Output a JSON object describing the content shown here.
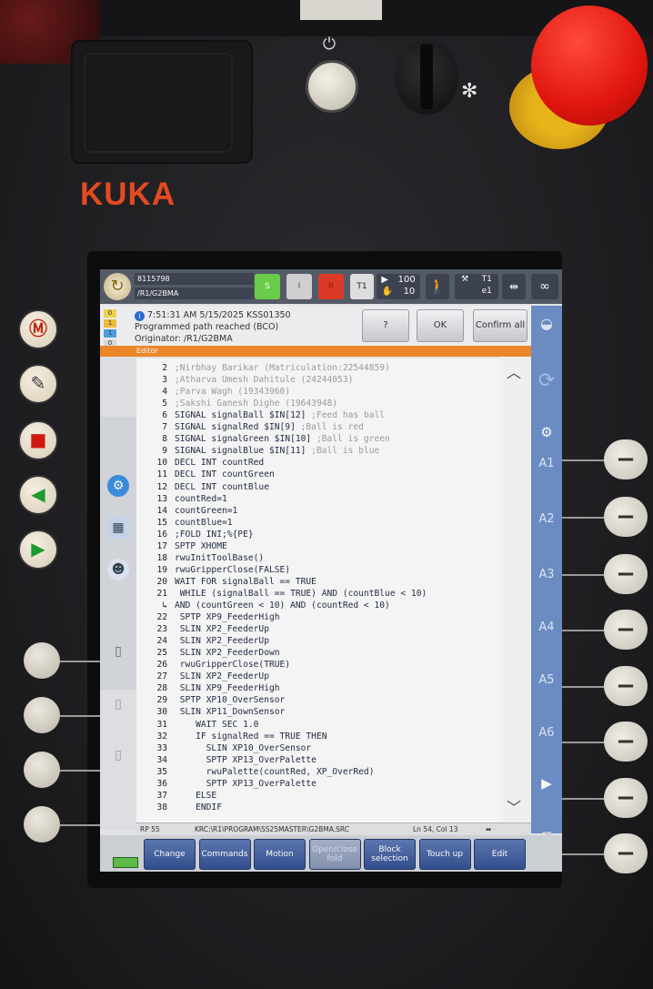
{
  "brand": {
    "logo": "KUKA"
  },
  "status_bar": {
    "robot_name": "8115798",
    "robot_path": "/R1/G2BMA",
    "submit_interpreter": "S",
    "drives": "I",
    "robot_interpreter": "R",
    "operating_mode": "T1",
    "override_program": "100",
    "override_jog": "10",
    "tool_label": "T1",
    "tool_value": "e1",
    "infinity_symbol": "∞"
  },
  "message": {
    "timestamp": "7:51:31 AM 5/15/2025 KSS01350",
    "text": "Programmed path reached (BCO)",
    "originator": "Originator: /R1/G2BMA",
    "counts": [
      "0",
      "1",
      "1",
      "0"
    ],
    "help_label": "?",
    "ok_label": "OK",
    "confirm_all_label": "Confirm all"
  },
  "editor": {
    "title": "Editor",
    "lines": [
      {
        "n": "2",
        "text": ";Nirbhay Barikar (Matriculation:22544859)",
        "comment": true
      },
      {
        "n": "3",
        "text": ";Atharva Umesh Dahitule (24244053)",
        "comment": true
      },
      {
        "n": "4",
        "text": ";Parva Wagh (19343960)",
        "comment": true
      },
      {
        "n": "5",
        "text": ";Sakshi Ganesh Dighe (19643948)",
        "comment": true
      },
      {
        "n": "6",
        "text": "SIGNAL signalBall $IN[12] ",
        "tail": ";Feed has ball"
      },
      {
        "n": "7",
        "text": "SIGNAL signalRed $IN[9] ",
        "tail": ";Ball is red"
      },
      {
        "n": "8",
        "text": "SIGNAL signalGreen $IN[10] ",
        "tail": ";Ball is green"
      },
      {
        "n": "9",
        "text": "SIGNAL signalBlue $IN[11] ",
        "tail": ";Ball is blue"
      },
      {
        "n": "10",
        "text": "DECL INT countRed"
      },
      {
        "n": "11",
        "text": "DECL INT countGreen"
      },
      {
        "n": "12",
        "text": "DECL INT countBlue"
      },
      {
        "n": "13",
        "text": "countRed=1"
      },
      {
        "n": "14",
        "text": "countGreen=1"
      },
      {
        "n": "15",
        "text": "countBlue=1"
      },
      {
        "n": "16",
        "text": ";FOLD INI;%{PE}"
      },
      {
        "n": "17",
        "text": "SPTP XHOME"
      },
      {
        "n": "18",
        "text": "rwuInitToolBase()"
      },
      {
        "n": "19",
        "text": "rwuGripperClose(FALSE)"
      },
      {
        "n": "20",
        "text": "WAIT FOR signalBall == TRUE"
      },
      {
        "n": "21",
        "text": " WHILE (signalBall == TRUE) AND (countBlue < 10)"
      },
      {
        "n": "↳",
        "text": "AND (countGreen < 10) AND (countRed < 10)",
        "wrap": true
      },
      {
        "n": "22",
        "text": " SPTP XP9_FeederHigh"
      },
      {
        "n": "23",
        "text": " SLIN XP2_FeederUp"
      },
      {
        "n": "24",
        "text": " SLIN XP2_FeederUp"
      },
      {
        "n": "25",
        "text": " SLIN XP2_FeederDown"
      },
      {
        "n": "26",
        "text": " rwuGripperClose(TRUE)"
      },
      {
        "n": "27",
        "text": " SLIN XP2_FeederUp"
      },
      {
        "n": "28",
        "text": " SLIN XP9_FeederHigh"
      },
      {
        "n": "29",
        "text": " SPTP XP10_OverSensor"
      },
      {
        "n": "30",
        "text": " SLIN XP11_DownSensor"
      },
      {
        "n": "31",
        "text": "    WAIT SEC 1.0"
      },
      {
        "n": "32",
        "text": "    IF signalRed == TRUE THEN"
      },
      {
        "n": "33",
        "text": "      SLIN XP10_OverSensor"
      },
      {
        "n": "34",
        "text": "      SPTP XP13_OverPalette"
      },
      {
        "n": "35",
        "text": "      rwuPalette(countRed, XP_OverRed)"
      },
      {
        "n": "36",
        "text": "      SPTP XP13_OverPalette"
      },
      {
        "n": "37",
        "text": "    ELSE"
      },
      {
        "n": "38",
        "text": "    ENDIF"
      }
    ]
  },
  "path_bar": {
    "left": "RP 55",
    "path": "KRC:\\R1\\PROGRAM\\SS25MASTER\\G2BMA.SRC",
    "position": "Ln 54, Col 13"
  },
  "axes": [
    "A1",
    "A2",
    "A3",
    "A4",
    "A5",
    "A6"
  ],
  "softkeys": [
    {
      "label": "Change",
      "enabled": true
    },
    {
      "label": "Commands",
      "enabled": true
    },
    {
      "label": "Motion",
      "enabled": true
    },
    {
      "label": "Open/close fold",
      "enabled": false
    },
    {
      "label": "Block selection",
      "enabled": true
    },
    {
      "label": "Touch up",
      "enabled": true
    },
    {
      "label": "Edit",
      "enabled": true
    }
  ],
  "colors": {
    "accent": "#f08a2a",
    "softkey": "#3d5a99",
    "estop": "#e0150f",
    "brand": "#e34a22"
  }
}
